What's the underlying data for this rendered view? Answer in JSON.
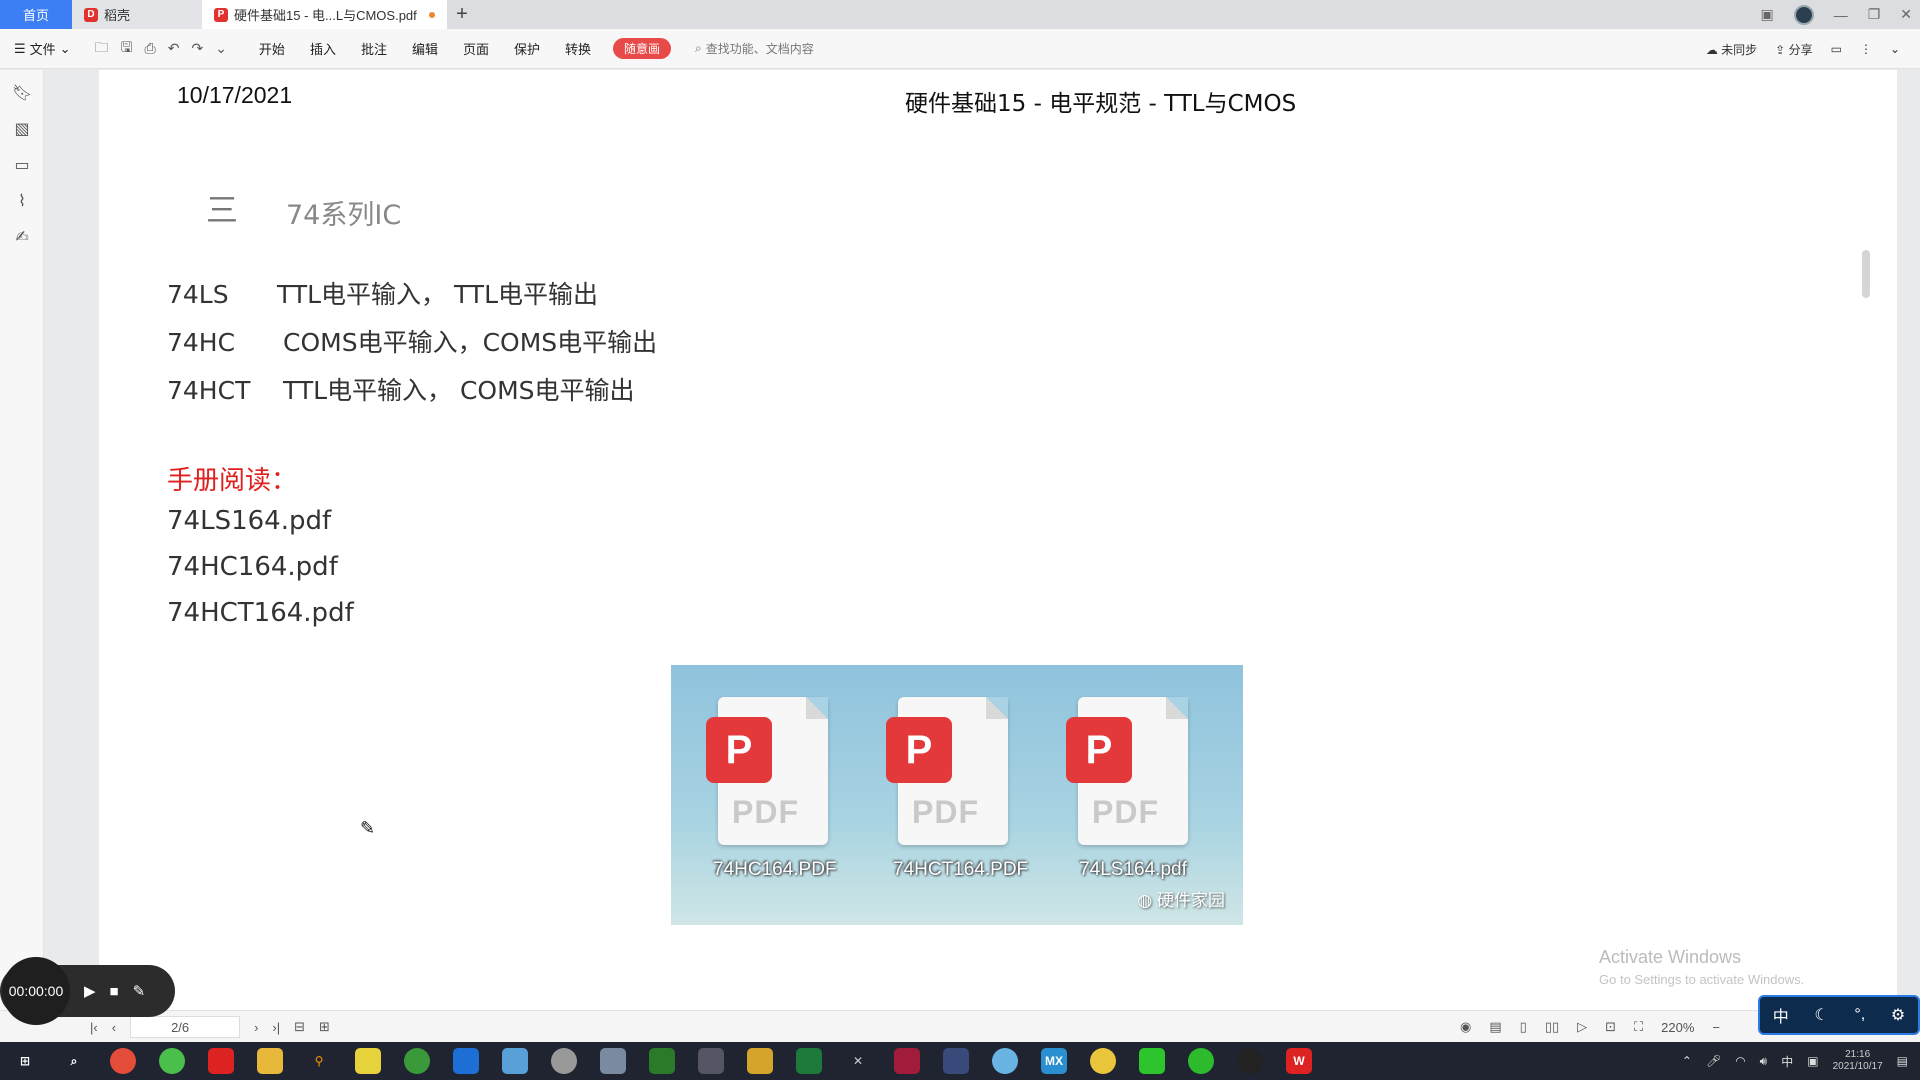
{
  "tabs": {
    "home": "首页",
    "tab2": "稻壳",
    "tab3": "硬件基础15 - 电...L与CMOS.pdf"
  },
  "toolbar": {
    "file": "文件",
    "menus": [
      "开始",
      "插入",
      "批注",
      "编辑",
      "页面",
      "保护",
      "转换"
    ],
    "pill": "随意画",
    "search_placeholder": "查找功能、文档内容",
    "sync": "未同步",
    "share": "分享"
  },
  "document": {
    "date": "10/17/2021",
    "title": "硬件基础15 - 电平规范 - TTL与CMOS",
    "section_marker": "三",
    "section_title": "74系列IC",
    "rows": [
      {
        "code": "74LS",
        "desc": "TTL电平输入， TTL电平输出"
      },
      {
        "code": "74HC",
        "desc": "COMS电平输入，COMS电平输出"
      },
      {
        "code": "74HCT",
        "desc": "TTL电平输入， COMS电平输出"
      }
    ],
    "manual_heading": "手册阅读：",
    "pdf_list": [
      "74LS164.pdf",
      "74HC164.pdf",
      "74HCT164.pdf"
    ],
    "image_files": [
      "74HC164.PDF",
      "74HCT164.PDF",
      "74LS164.pdf"
    ],
    "image_watermark": "硬件家园",
    "pdf_word": "PDF"
  },
  "overlay": {
    "activate_title": "Activate Windows",
    "activate_sub": "Go to Settings to activate Windows."
  },
  "statusbar": {
    "page": "2/6",
    "zoom": "220%"
  },
  "recorder": {
    "time": "00:00:00"
  },
  "ime": {
    "lang": "中"
  },
  "taskbar": {
    "time": "21:16",
    "date": "2021/10/17",
    "tray_lang": "中"
  }
}
